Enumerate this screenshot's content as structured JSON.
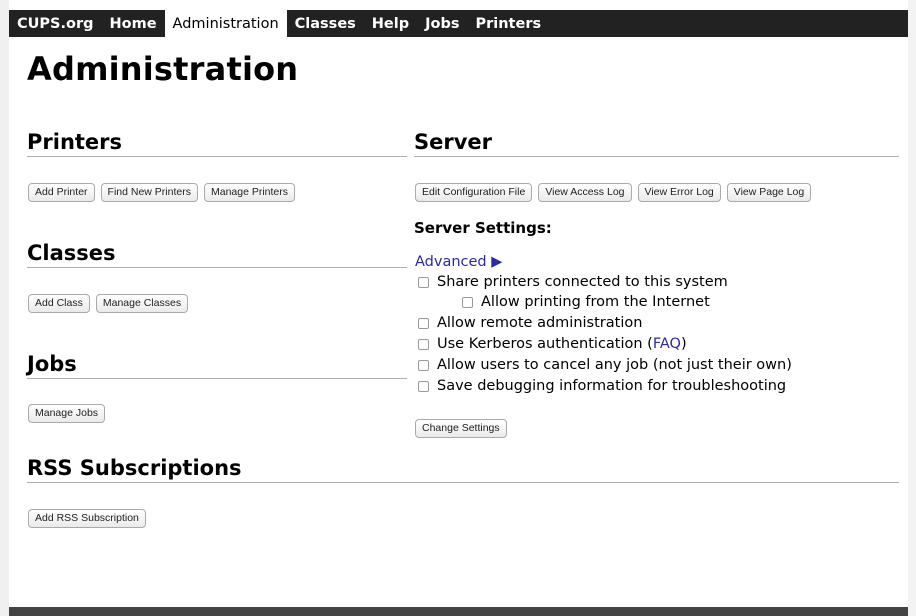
{
  "nav": {
    "items": [
      "CUPS.org",
      "Home",
      "Administration",
      "Classes",
      "Help",
      "Jobs",
      "Printers"
    ],
    "active": "Administration"
  },
  "page": {
    "title": "Administration"
  },
  "printers": {
    "heading": "Printers",
    "buttons": [
      "Add Printer",
      "Find New Printers",
      "Manage Printers"
    ]
  },
  "classes": {
    "heading": "Classes",
    "buttons": [
      "Add Class",
      "Manage Classes"
    ]
  },
  "jobs": {
    "heading": "Jobs",
    "buttons": [
      "Manage Jobs"
    ]
  },
  "rss": {
    "heading": "RSS Subscriptions",
    "buttons": [
      "Add RSS Subscription"
    ]
  },
  "server": {
    "heading": "Server",
    "buttons": [
      "Edit Configuration File",
      "View Access Log",
      "View Error Log",
      "View Page Log"
    ],
    "settings_label": "Server Settings:",
    "advanced_label": "Advanced ▶",
    "options": [
      {
        "label": "Share printers connected to this system",
        "checked": false
      },
      {
        "label": "Allow printing from the Internet",
        "checked": false
      },
      {
        "label": "Allow remote administration",
        "checked": false
      },
      {
        "label": "Use Kerberos authentication (",
        "link": "FAQ",
        "suffix": ")",
        "checked": false
      },
      {
        "label": "Allow users to cancel any job (not just their own)",
        "checked": false
      },
      {
        "label": "Save debugging information for troubleshooting",
        "checked": false
      }
    ],
    "change_button": "Change Settings"
  },
  "colors": {
    "topbar": "#222222",
    "link": "#2a2aa8"
  }
}
